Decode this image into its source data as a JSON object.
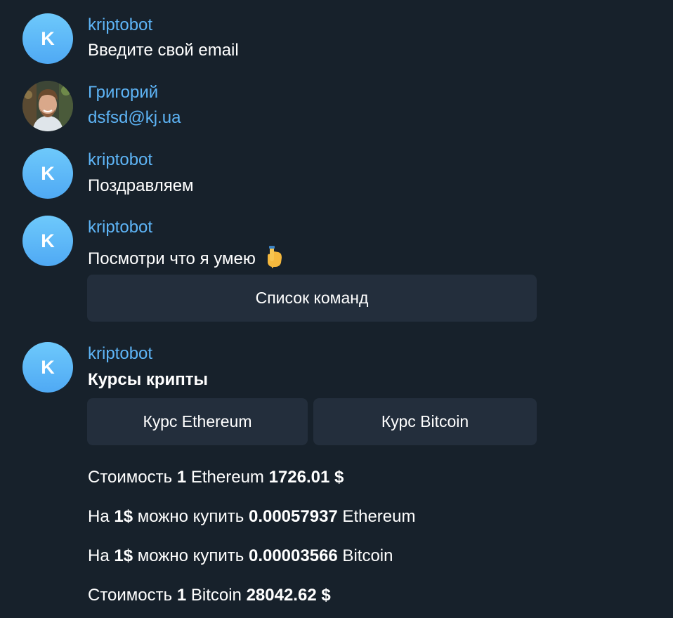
{
  "messages": [
    {
      "sender": "kriptobot",
      "avatar_letter": "K",
      "text": "Введите свой email"
    },
    {
      "sender": "Григорий",
      "text": "dsfsd@kj.ua"
    },
    {
      "sender": "kriptobot",
      "avatar_letter": "K",
      "text": "Поздравляем"
    },
    {
      "sender": "kriptobot",
      "avatar_letter": "K",
      "text": "Посмотри что я умею",
      "emoji": "point-down-hand-icon",
      "button": "Список команд"
    },
    {
      "sender": "kriptobot",
      "avatar_letter": "K",
      "text": "Курсы крипты",
      "buttons": [
        "Курс Ethereum",
        "Курс Bitcoin"
      ]
    }
  ],
  "rates": [
    {
      "p1": "Стоимость ",
      "b1": "1",
      "p2": " Ethereum ",
      "b2": "1726.01 $"
    },
    {
      "p1": "На ",
      "b1": "1$",
      "p2": " можно купить ",
      "b2": "0.00057937",
      "p3": " Ethereum"
    },
    {
      "p1": "На ",
      "b1": "1$",
      "p2": " можно купить ",
      "b2": "0.00003566",
      "p3": " Bitcoin"
    },
    {
      "p1": "Стоимость ",
      "b1": "1",
      "p2": " Bitcoin ",
      "b2": "28042.62 $"
    }
  ],
  "colors": {
    "background": "#17212b",
    "sender_name": "#5eb5f7",
    "button_bg": "#232e3c",
    "bot_avatar": "#5eb5f7"
  }
}
